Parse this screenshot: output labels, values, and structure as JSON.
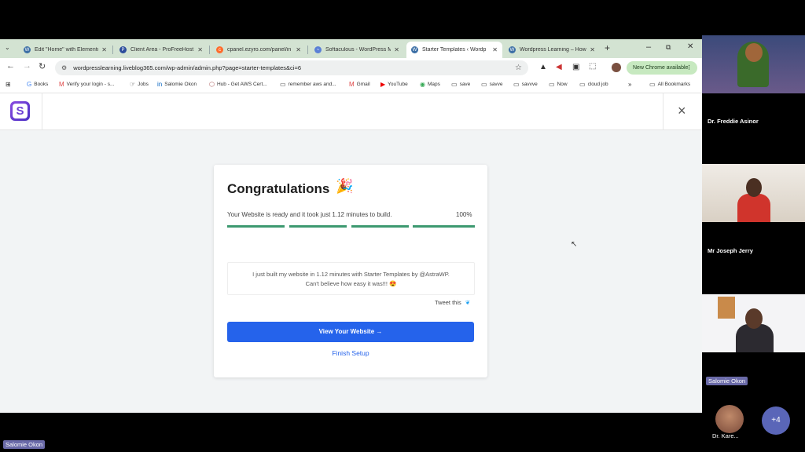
{
  "browser": {
    "tabs": [
      {
        "label": "Edit \"Home\" with Elementor",
        "icon": "wordpress-icon"
      },
      {
        "label": "Client Area - ProFreeHost",
        "icon": "profreehost-icon"
      },
      {
        "label": "cpanel.ezyro.com/panel/in",
        "icon": "cpanel-icon"
      },
      {
        "label": "Softaculous - WordPress M",
        "icon": "softaculous-icon"
      },
      {
        "label": "Starter Templates ‹ Wordp",
        "icon": "wordpress-icon"
      },
      {
        "label": "Wordpress Learning – How",
        "icon": "wordpress-icon"
      }
    ],
    "url": "wordpresslearning.liveblog365.com/wp-admin/admin.php?page=starter-templates&ci=6",
    "update_label": "New Chrome available",
    "bookmarks": [
      "Books",
      "Verify your login - s...",
      "Jobs",
      "Salomie Okon",
      "Hub - Get AWS Cert...",
      "remember aws and...",
      "Gmail",
      "YouTube",
      "Maps",
      "save",
      "savve",
      "savvve",
      "Now",
      "cloud job"
    ],
    "all_bookmarks": "All Bookmarks"
  },
  "app": {
    "logo_letter": "S",
    "close": "×"
  },
  "card": {
    "title": "Congratulations",
    "emoji": "🎉",
    "status": "Your Website is ready and it took just 1.12 minutes to build.",
    "percent": "100%",
    "progress": 1.0,
    "tweet_text_1": "I just built my website in 1.12 minutes with Starter Templates by @AstraWP.",
    "tweet_text_2": "Can't believe how easy it was!!! 😍",
    "tweet_link": "Tweet this",
    "view_button": "View Your Website →",
    "finish_link": "Finish Setup"
  },
  "participants": {
    "p1": "Dr. Freddie Asinor",
    "p2": "Mr Joseph Jerry",
    "p3": "Salomie Okon",
    "p4": "Dr. Kare...",
    "more": "+4",
    "presenter": "Salomie Okon"
  },
  "colors": {
    "accent": "#2563eb",
    "progress": "#3d9970",
    "logo": "#6b3fd4"
  }
}
